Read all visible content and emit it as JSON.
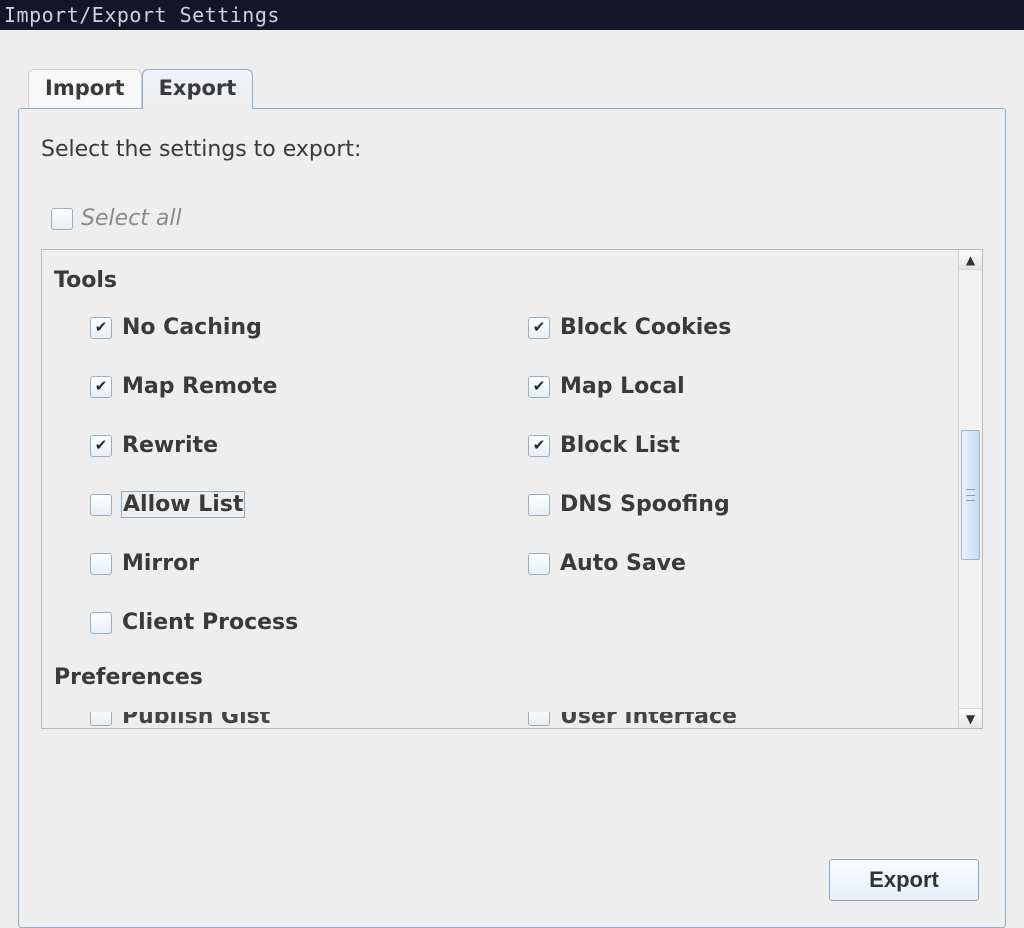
{
  "window": {
    "title": "Import/Export Settings"
  },
  "tabs": {
    "import_label": "Import",
    "export_label": "Export",
    "active": "export"
  },
  "panel": {
    "prompt": "Select the settings to export:",
    "select_all_label": "Select all",
    "select_all_checked": false,
    "groups": [
      {
        "title": "Tools",
        "options": [
          {
            "label": "No Caching",
            "checked": true,
            "focused": false
          },
          {
            "label": "Block Cookies",
            "checked": true,
            "focused": false
          },
          {
            "label": "Map Remote",
            "checked": true,
            "focused": false
          },
          {
            "label": "Map Local",
            "checked": true,
            "focused": false
          },
          {
            "label": "Rewrite",
            "checked": true,
            "focused": false
          },
          {
            "label": "Block List",
            "checked": true,
            "focused": false
          },
          {
            "label": "Allow List",
            "checked": false,
            "focused": true
          },
          {
            "label": "DNS Spoofing",
            "checked": false,
            "focused": false
          },
          {
            "label": "Mirror",
            "checked": false,
            "focused": false
          },
          {
            "label": "Auto Save",
            "checked": false,
            "focused": false
          },
          {
            "label": "Client Process",
            "checked": false,
            "focused": false
          }
        ]
      },
      {
        "title": "Preferences",
        "options_partial": [
          {
            "label": "Publish Gist",
            "checked": false
          },
          {
            "label": "User Interface",
            "checked": false
          }
        ]
      }
    ],
    "export_button_label": "Export"
  }
}
